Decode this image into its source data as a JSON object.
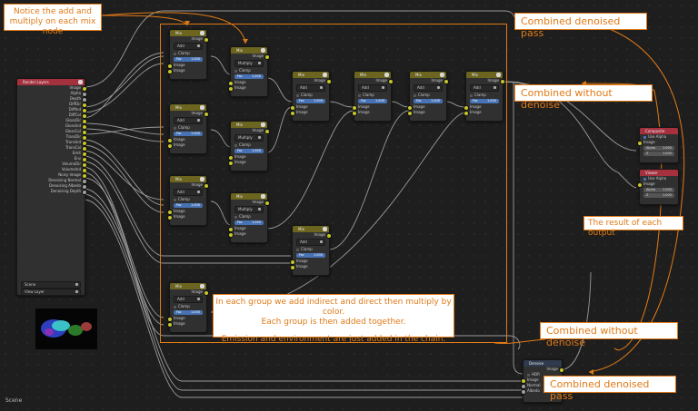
{
  "annotations": {
    "top_left": "Notice the add and multiply on each mix node",
    "combined_denoised_top": "Combined denoised pass",
    "combined_without_top": "Combined without denoise",
    "result_each_output": "The result of each output",
    "center_l1": "In each group we add indirect and direct then multiply by color.",
    "center_l2": "Each group is then added together.",
    "center_l3": "Emission and environment are just added in the chain.",
    "combined_without_bottom": "Combined without denoise",
    "combined_denoised_bottom": "Combined denoised pass"
  },
  "render_layers": {
    "title": "Render Layers",
    "outputs": [
      "Image",
      "Alpha",
      "Depth",
      "DiffDir",
      "DiffInd",
      "DiffCol",
      "GlossDir",
      "GlossInd",
      "GlossCol",
      "TransDir",
      "TransInd",
      "TransCol",
      "Emit",
      "Env",
      "VolumeDir",
      "VolumeInd",
      "Noisy Image",
      "Denoising Normal",
      "Denoising Albedo",
      "Denoising Depth"
    ],
    "scene": "Scene",
    "view_layer": "View Layer"
  },
  "mix_node": {
    "title": "Mix",
    "out_label": "Image",
    "clamp_label": "Clamp",
    "fac_label": "Fac",
    "fac_value": "1.000",
    "image_label": "Image",
    "add_mode": "Add",
    "multiply_mode": "Multiply"
  },
  "composite": {
    "title": "Composite",
    "use_alpha": "Use Alpha",
    "image": "Image",
    "alpha": "Alpha",
    "alpha_value": "1.000",
    "z": "Z",
    "z_value": "1.000"
  },
  "viewer": {
    "title": "Viewer",
    "use_alpha": "Use Alpha",
    "image": "Image",
    "alpha": "Alpha",
    "alpha_value": "1.000",
    "z": "Z",
    "z_value": "1.000"
  },
  "denoise": {
    "title": "Denoise",
    "out": "Image",
    "hdr": "HDR",
    "inputs": [
      "Image",
      "Normal",
      "Albedo"
    ]
  },
  "status_bar": {
    "scene": "Scene"
  },
  "colors": {
    "annotation": "#e07a16",
    "mix_header": "#6b6520",
    "layer_header": "#a5313f",
    "image_socket": "#c7c729",
    "value_socket": "#a1a1a1",
    "fac_blue": "#4772b3"
  }
}
